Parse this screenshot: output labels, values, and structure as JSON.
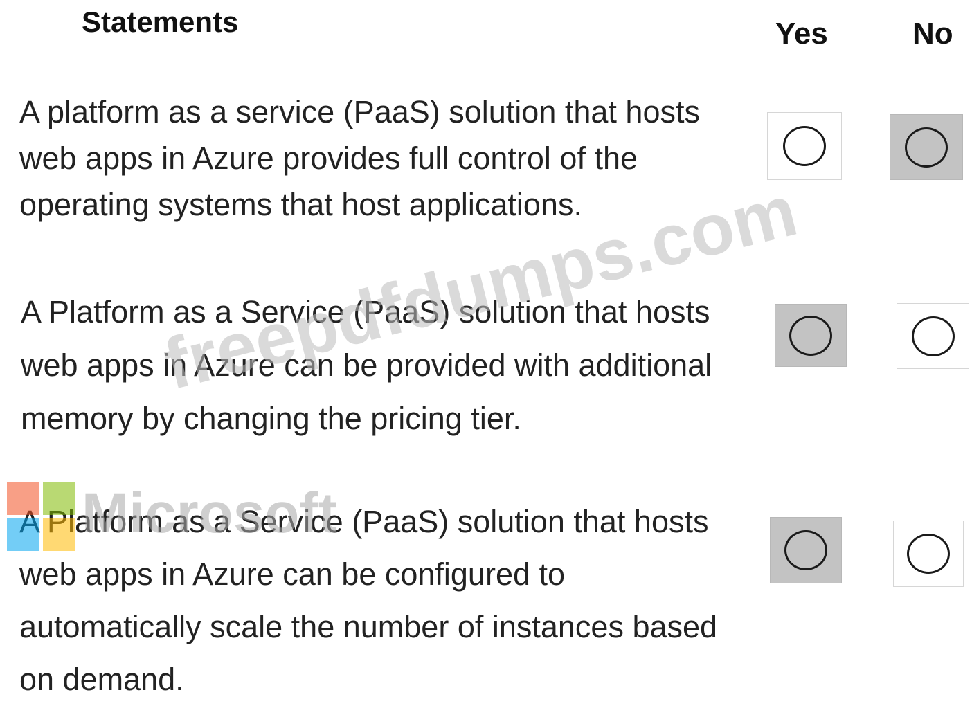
{
  "headers": {
    "statements": "Statements",
    "yes": "Yes",
    "no": "No"
  },
  "statements": [
    {
      "lines": [
        "A platform as a service (PaaS) solution that hosts",
        "web apps in Azure provides full control of the",
        "operating systems that host applications."
      ],
      "selected": "No"
    },
    {
      "lines": [
        "A Platform as a Service (PaaS) solution that hosts",
        "web apps in Azure can be provided with additional",
        "memory by changing the pricing tier."
      ],
      "selected": "Yes"
    },
    {
      "lines": [
        "A Platform as a Service (PaaS) solution that hosts",
        "web apps in Azure can be configured to",
        "automatically scale the number of instances based",
        "on demand."
      ],
      "selected": "Yes"
    }
  ],
  "watermarks": {
    "site": "freepdfdumps.com",
    "brand": "Microsoft"
  },
  "colors": {
    "selected_fill": "#c3c3c3",
    "logo_red": "#f25022",
    "logo_green": "#7fba00",
    "logo_blue": "#00a4ef",
    "logo_yellow": "#ffb900"
  }
}
